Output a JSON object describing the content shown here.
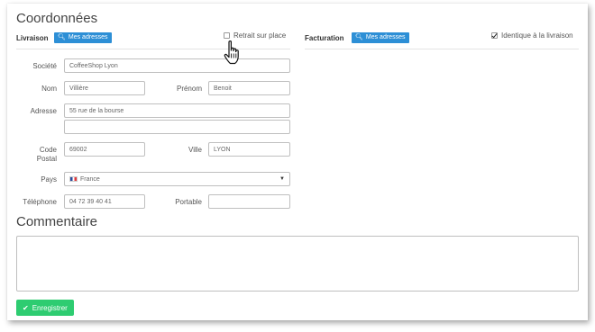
{
  "coordonnees": {
    "title": "Coordonnées"
  },
  "livraison": {
    "label": "Livraison",
    "addresses_button": "Mes adresses",
    "pickup_label": "Retrait sur place",
    "pickup_checked": false,
    "fields": {
      "societe": {
        "label": "Société",
        "value": "CoffeeShop Lyon"
      },
      "nom": {
        "label": "Nom",
        "value": "Villière"
      },
      "prenom": {
        "label": "Prénom",
        "value": "Benoit"
      },
      "adresse": {
        "label": "Adresse",
        "line1": "55 rue de la bourse",
        "line2": ""
      },
      "code_postal": {
        "label_line1": "Code",
        "label_line2": "Postal",
        "value": "69002"
      },
      "ville": {
        "label": "Ville",
        "value": "LYON"
      },
      "pays": {
        "label": "Pays",
        "value": "France"
      },
      "telephone": {
        "label": "Téléphone",
        "value": "04 72 39 40 41"
      },
      "portable": {
        "label": "Portable",
        "value": ""
      }
    }
  },
  "facturation": {
    "label": "Facturation",
    "addresses_button": "Mes adresses",
    "same_label": "Identique à la livraison",
    "same_checked": true
  },
  "commentaire": {
    "title": "Commentaire",
    "value": ""
  },
  "save_button": "Enregistrer",
  "colors": {
    "primary": "#2d8fd6",
    "success": "#2ecc71"
  },
  "icons": {
    "address_button": "search-icon",
    "save": "check-icon",
    "country": "france-flag-icon",
    "cursor": "hand-pointer-icon"
  }
}
